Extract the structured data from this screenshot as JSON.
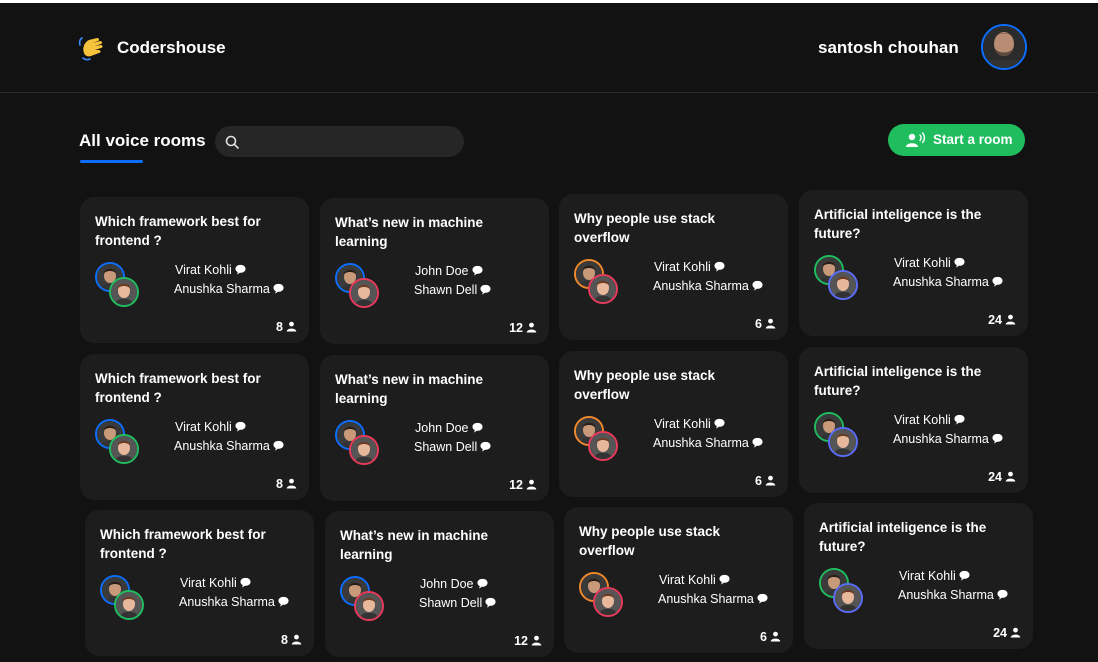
{
  "header": {
    "brand": "Codershouse",
    "logo_icon": "waving-hand-icon",
    "username": "santosh chouhan",
    "avatar_icon": "user-avatar"
  },
  "toolbar": {
    "heading": "All voice rooms",
    "search_placeholder": "",
    "search_icon": "search-icon",
    "start_room_label": "Start a room",
    "start_room_icon": "speaking-user-icon"
  },
  "colors": {
    "background": "#121212",
    "card": "#1d1d1d",
    "accent_blue": "#0d6efd",
    "accent_green": "#20bd5f"
  },
  "rooms": [
    {
      "title": "Which framework best for frontend ?",
      "speakers": [
        "Virat Kohli",
        "Anushka Sharma"
      ],
      "count": "8",
      "ring1": "#0d6efd",
      "ring2": "#20bd5f"
    },
    {
      "title": "What’s new in machine learning",
      "speakers": [
        "John Doe",
        "Shawn  Dell"
      ],
      "count": "12",
      "ring1": "#0d6efd",
      "ring2": "#e83a5b"
    },
    {
      "title": "Why people use stack overflow",
      "speakers": [
        "Virat Kohli",
        "Anushka Sharma"
      ],
      "count": "6",
      "ring1": "#f0892b",
      "ring2": "#e83a5b"
    },
    {
      "title": "Artificial inteligence is the future?",
      "speakers": [
        "Virat Kohli",
        "Anushka Sharma"
      ],
      "count": "24",
      "ring1": "#20bd5f",
      "ring2": "#5b6cf7"
    },
    {
      "title": "Which framework best for frontend ?",
      "speakers": [
        "Virat Kohli",
        "Anushka Sharma"
      ],
      "count": "8",
      "ring1": "#0d6efd",
      "ring2": "#20bd5f"
    },
    {
      "title": "What’s new in machine learning",
      "speakers": [
        "John Doe",
        "Shawn  Dell"
      ],
      "count": "12",
      "ring1": "#0d6efd",
      "ring2": "#e83a5b"
    },
    {
      "title": "Why people use stack overflow",
      "speakers": [
        "Virat Kohli",
        "Anushka Sharma"
      ],
      "count": "6",
      "ring1": "#f0892b",
      "ring2": "#e83a5b"
    },
    {
      "title": "Artificial inteligence is the future?",
      "speakers": [
        "Virat Kohli",
        "Anushka Sharma"
      ],
      "count": "24",
      "ring1": "#20bd5f",
      "ring2": "#5b6cf7"
    },
    {
      "title": "Which framework best for frontend ?",
      "speakers": [
        "Virat Kohli",
        "Anushka Sharma"
      ],
      "count": "8",
      "ring1": "#0d6efd",
      "ring2": "#20bd5f"
    },
    {
      "title": "What’s new in machine learning",
      "speakers": [
        "John Doe",
        "Shawn  Dell"
      ],
      "count": "12",
      "ring1": "#0d6efd",
      "ring2": "#e83a5b"
    },
    {
      "title": "Why people use stack overflow",
      "speakers": [
        "Virat Kohli",
        "Anushka Sharma"
      ],
      "count": "6",
      "ring1": "#f0892b",
      "ring2": "#e83a5b"
    },
    {
      "title": "Artificial inteligence is the future?",
      "speakers": [
        "Virat Kohli",
        "Anushka Sharma"
      ],
      "count": "24",
      "ring1": "#20bd5f",
      "ring2": "#5b6cf7"
    }
  ]
}
